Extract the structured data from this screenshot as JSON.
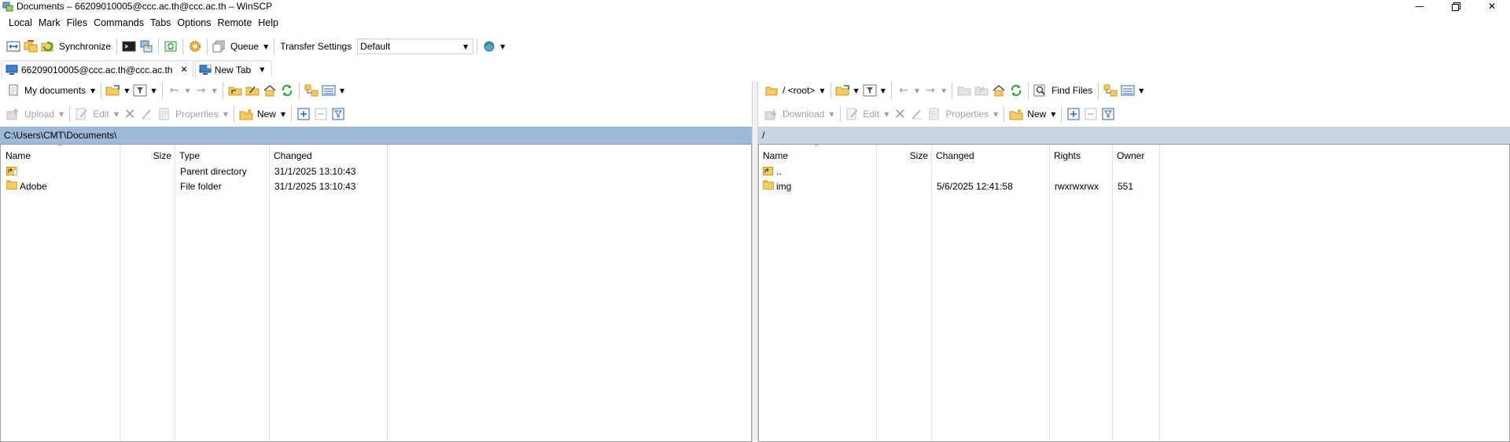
{
  "window": {
    "title": "Documents – 66209010005@ccc.ac.th@ccc.ac.th – WinSCP",
    "controls": [
      "minimize-icon",
      "restore-icon",
      "close-icon"
    ]
  },
  "menu": [
    "Local",
    "Mark",
    "Files",
    "Commands",
    "Tabs",
    "Options",
    "Remote",
    "Help"
  ],
  "toolbar": {
    "synchronize_label": "Synchronize",
    "queue_label": "Queue",
    "transfer_settings_label": "Transfer Settings",
    "transfer_settings_value": "Default"
  },
  "tabs": [
    {
      "label": "66209010005@ccc.ac.th@ccc.ac.th",
      "active": true
    },
    {
      "label": "New Tab",
      "active": false
    }
  ],
  "left_panel": {
    "location_label": "My documents",
    "upload_label": "Upload",
    "edit_label": "Edit",
    "properties_label": "Properties",
    "new_label": "New",
    "path": "C:\\Users\\CMT\\Documents\\",
    "columns": [
      "Name",
      "Size",
      "Type",
      "Changed"
    ],
    "rows": [
      {
        "name": "..",
        "size": "",
        "type": "Parent directory",
        "changed": "31/1/2025 13:10:43",
        "icon": "parent-dir-icon"
      },
      {
        "name": "Adobe",
        "size": "",
        "type": "File folder",
        "changed": "31/1/2025 13:10:43",
        "icon": "folder-icon"
      }
    ]
  },
  "right_panel": {
    "location_label": "/ <root>",
    "find_files_label": "Find Files",
    "download_label": "Download",
    "edit_label": "Edit",
    "properties_label": "Properties",
    "new_label": "New",
    "path": "/",
    "columns": [
      "Name",
      "Size",
      "Changed",
      "Rights",
      "Owner"
    ],
    "rows": [
      {
        "name": "..",
        "size": "",
        "changed": "",
        "rights": "",
        "owner": "",
        "icon": "parent-dir-icon"
      },
      {
        "name": "img",
        "size": "",
        "changed": "5/6/2025 12:41:58",
        "rights": "rwxrwxrwx",
        "owner": "551",
        "icon": "folder-icon"
      }
    ]
  },
  "colors": {
    "left_path_bg": "#9db9d6",
    "right_path_bg": "#c9d6e2",
    "folder": "#f5cd5c",
    "refresh_green": "#2e9e3e",
    "disabled_text": "#a0a0a0"
  }
}
